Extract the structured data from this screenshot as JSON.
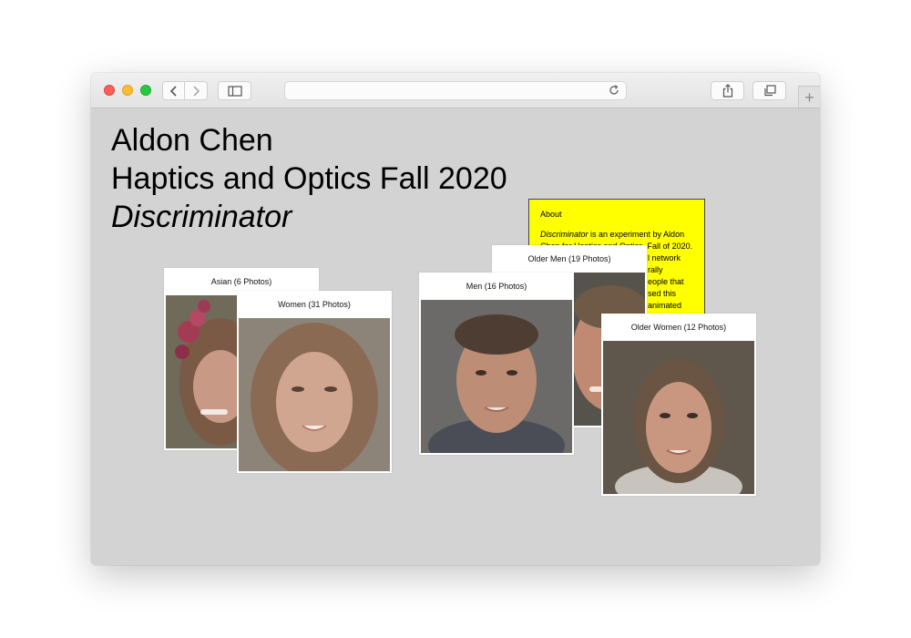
{
  "page": {
    "title": "Aldon Chen",
    "subtitle": "Haptics and Optics Fall 2020",
    "project": "Discriminator"
  },
  "toolbar": {
    "back_icon": "chevron-left-icon",
    "forward_icon": "chevron-right-icon",
    "sidebar_icon": "sidebar-icon",
    "share_icon": "share-icon",
    "tabs_icon": "tabs-overview-icon",
    "reload_icon": "reload-icon",
    "new_tab_label": "+"
  },
  "about": {
    "title": "About",
    "lines": [
      {
        "lead": "Discriminator",
        "rest": " is an experiment by Aldon"
      },
      {
        "lead": "",
        "rest": "Chen for Haptics and Optics, Fall of 2020."
      },
      {
        "lead": "",
        "rest": "l network"
      },
      {
        "lead": "",
        "rest": "rally"
      },
      {
        "lead": "",
        "rest": "eople that"
      },
      {
        "lead": "",
        "rest": "sed this"
      },
      {
        "lead": "",
        "rest": "animated"
      }
    ]
  },
  "cards": [
    {
      "id": "asian",
      "caption": "Asian (6 Photos)",
      "subject": "woman-flower-crown"
    },
    {
      "id": "older-men",
      "caption": "Older Men (19 Photos)",
      "subject": "older-man"
    },
    {
      "id": "women",
      "caption": "Women (31 Photos)",
      "subject": "woman-average-face"
    },
    {
      "id": "men",
      "caption": "Men (16 Photos)",
      "subject": "man-average-face"
    },
    {
      "id": "older-women",
      "caption": "Older Women (12 Photos)",
      "subject": "older-woman-average-face"
    }
  ],
  "colors": {
    "page_background": "#d3d3d3",
    "about_background": "#ffff00",
    "close": "#fe5f57",
    "minimize": "#febc2e",
    "zoom": "#28c840"
  }
}
